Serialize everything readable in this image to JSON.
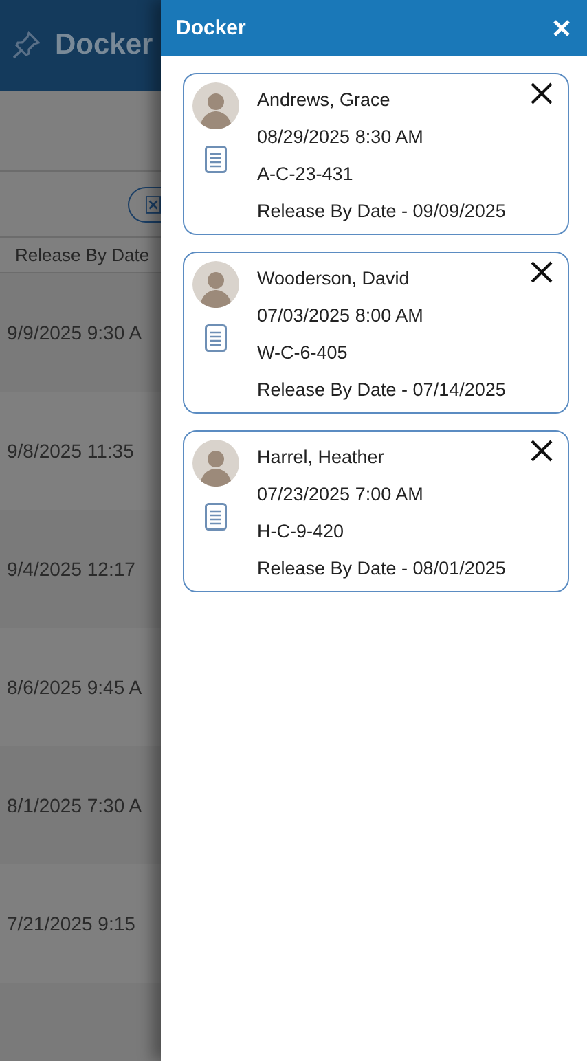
{
  "app_header": {
    "title": "Docker"
  },
  "table": {
    "columns": [
      "Release By Date"
    ],
    "rows": [
      {
        "release_by_date": "9/9/2025 9:30 A"
      },
      {
        "release_by_date": "9/8/2025 11:35"
      },
      {
        "release_by_date": "9/4/2025 12:17"
      },
      {
        "release_by_date": "8/6/2025 9:45 A"
      },
      {
        "release_by_date": "8/1/2025 7:30 A"
      },
      {
        "release_by_date": "7/21/2025 9:15"
      }
    ]
  },
  "drawer": {
    "title": "Docker",
    "cards": [
      {
        "name": "Andrews, Grace",
        "appointment": "08/29/2025 8:30 AM",
        "code": "A-C-23-431",
        "release": "Release By Date - 09/09/2025"
      },
      {
        "name": "Wooderson, David",
        "appointment": "07/03/2025 8:00 AM",
        "code": "W-C-6-405",
        "release": "Release By Date - 07/14/2025"
      },
      {
        "name": "Harrel, Heather",
        "appointment": "07/23/2025 7:00 AM",
        "code": "H-C-9-420",
        "release": "Release By Date - 08/01/2025"
      }
    ]
  }
}
